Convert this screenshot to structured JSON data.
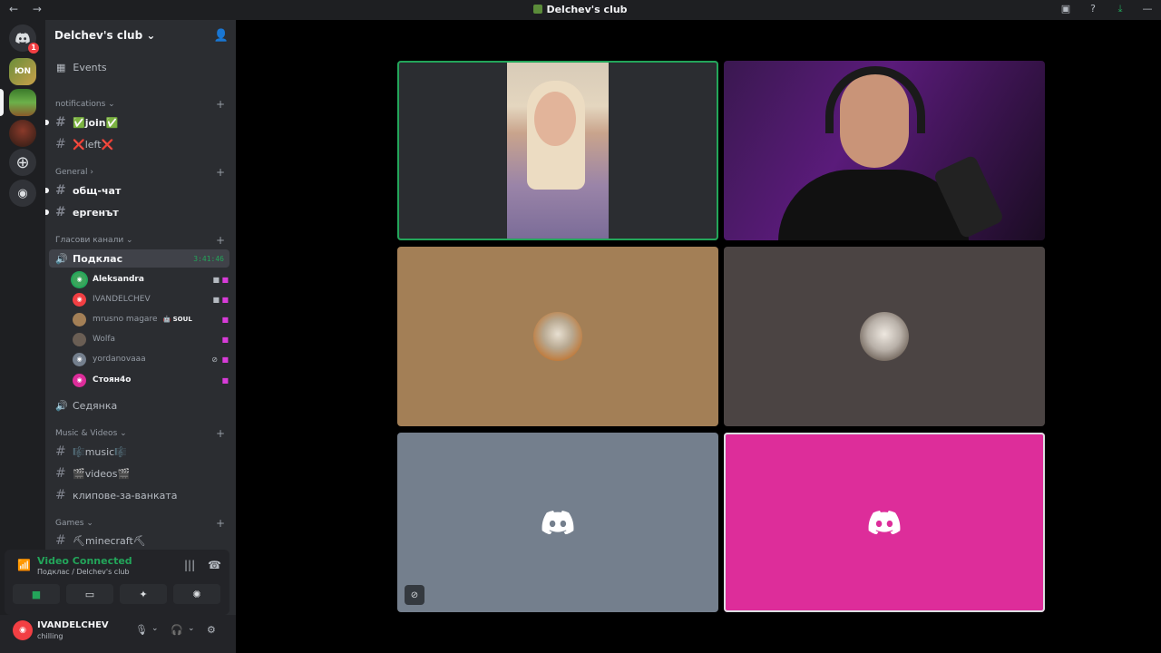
{
  "titlebar": {
    "title": "Delchev's club",
    "nav": "← →"
  },
  "server": {
    "name": "Delchev's club ⌄"
  },
  "events_label": "Events",
  "categories": {
    "notifications": "notifications ⌄",
    "general": "General ›",
    "voice": "Гласови канали ⌄",
    "music": "Music & Videos ⌄",
    "games": "Games ⌄"
  },
  "channels": {
    "join": "✅join✅",
    "left": "❌left❌",
    "obsht": "общ-чат",
    "ergenat": "ергенът",
    "music": "🎼music🎼",
    "videos": "🎬videos🎬",
    "klipove": "клипове-за-ванката",
    "minecraft": "⛏minecraft⛏"
  },
  "voice": {
    "active_channel": "Подклас",
    "timer": "3:41:46",
    "other_channel": "Седянка",
    "users": [
      {
        "name": "Aleksandra",
        "bright": true,
        "speaking": true
      },
      {
        "name": "IVANDELCHEV",
        "bright": false
      },
      {
        "name": "mrusno magare",
        "tag": "🤖 SOUL"
      },
      {
        "name": "Wolfa"
      },
      {
        "name": "yordanovaaa"
      },
      {
        "name": "Стоян4о",
        "bright": true
      }
    ]
  },
  "voice_panel": {
    "status": "Video Connected",
    "sub": "Подклас / Delchev's club"
  },
  "user": {
    "name": "IVANDELCHEV",
    "status": "chilling"
  },
  "guild_badge": "1",
  "guild_label": "ЮN"
}
